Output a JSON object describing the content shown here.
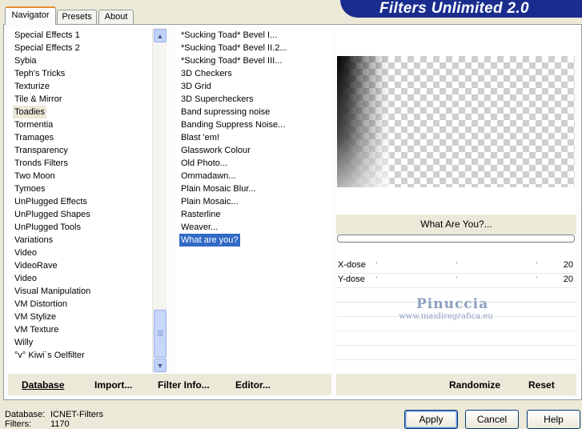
{
  "app": {
    "title": "Filters Unlimited 2.0"
  },
  "tabs": [
    {
      "label": "Navigator",
      "active": true
    },
    {
      "label": "Presets",
      "active": false
    },
    {
      "label": "About",
      "active": false
    }
  ],
  "categories": {
    "items": [
      "Special Effects 1",
      "Special Effects 2",
      "Sybia",
      "Teph's Tricks",
      "Texturize",
      "Tile & Mirror",
      "Toadies",
      "Tormentia",
      "Tramages",
      "Transparency",
      "Tronds Filters",
      "Two Moon",
      "Tymoes",
      "UnPlugged Effects",
      "UnPlugged Shapes",
      "UnPlugged Tools",
      "Variations",
      "Video",
      "VideoRave",
      "Video",
      "Visual Manipulation",
      "VM Distortion",
      "VM Stylize",
      "VM Texture",
      "Willy",
      "°v° Kiwi`s Oelfilter"
    ],
    "selected": "Toadies"
  },
  "filters": {
    "items": [
      "*Sucking Toad*  Bevel I...",
      "*Sucking Toad*  Bevel II.2...",
      "*Sucking Toad*  Bevel III...",
      "3D Checkers",
      "3D Grid",
      "3D Supercheckers",
      "Band supressing noise",
      "Banding Suppress Noise...",
      "Blast 'em!",
      "Glasswork Colour",
      "Old Photo...",
      "Ommadawn...",
      "Plain Mosaic Blur...",
      "Plain Mosaic...",
      "Rasterline",
      "Weaver...",
      "What are you?"
    ],
    "selected": "What are you?"
  },
  "preview": {
    "filter_name": "What Are You?...",
    "progress": 0
  },
  "params": [
    {
      "label": "X-dose",
      "value": "20"
    },
    {
      "label": "Y-dose",
      "value": "20"
    }
  ],
  "watermark": {
    "line1": "Pinuccia",
    "line2": "www.maidiregrafica.eu"
  },
  "left_buttons": {
    "database": "Database",
    "import": "Import...",
    "filter_info": "Filter Info...",
    "editor": "Editor..."
  },
  "right_buttons": {
    "randomize": "Randomize",
    "reset": "Reset"
  },
  "status": {
    "database_label": "Database:",
    "database_value": "ICNET-Filters",
    "filters_label": "Filters:",
    "filters_value": "1170"
  },
  "dialog_buttons": {
    "apply": "Apply",
    "cancel": "Cancel",
    "help": "Help"
  },
  "colors": {
    "banner": "#1a2d8f",
    "selection": "#316ac5",
    "face": "#ece9d8"
  }
}
